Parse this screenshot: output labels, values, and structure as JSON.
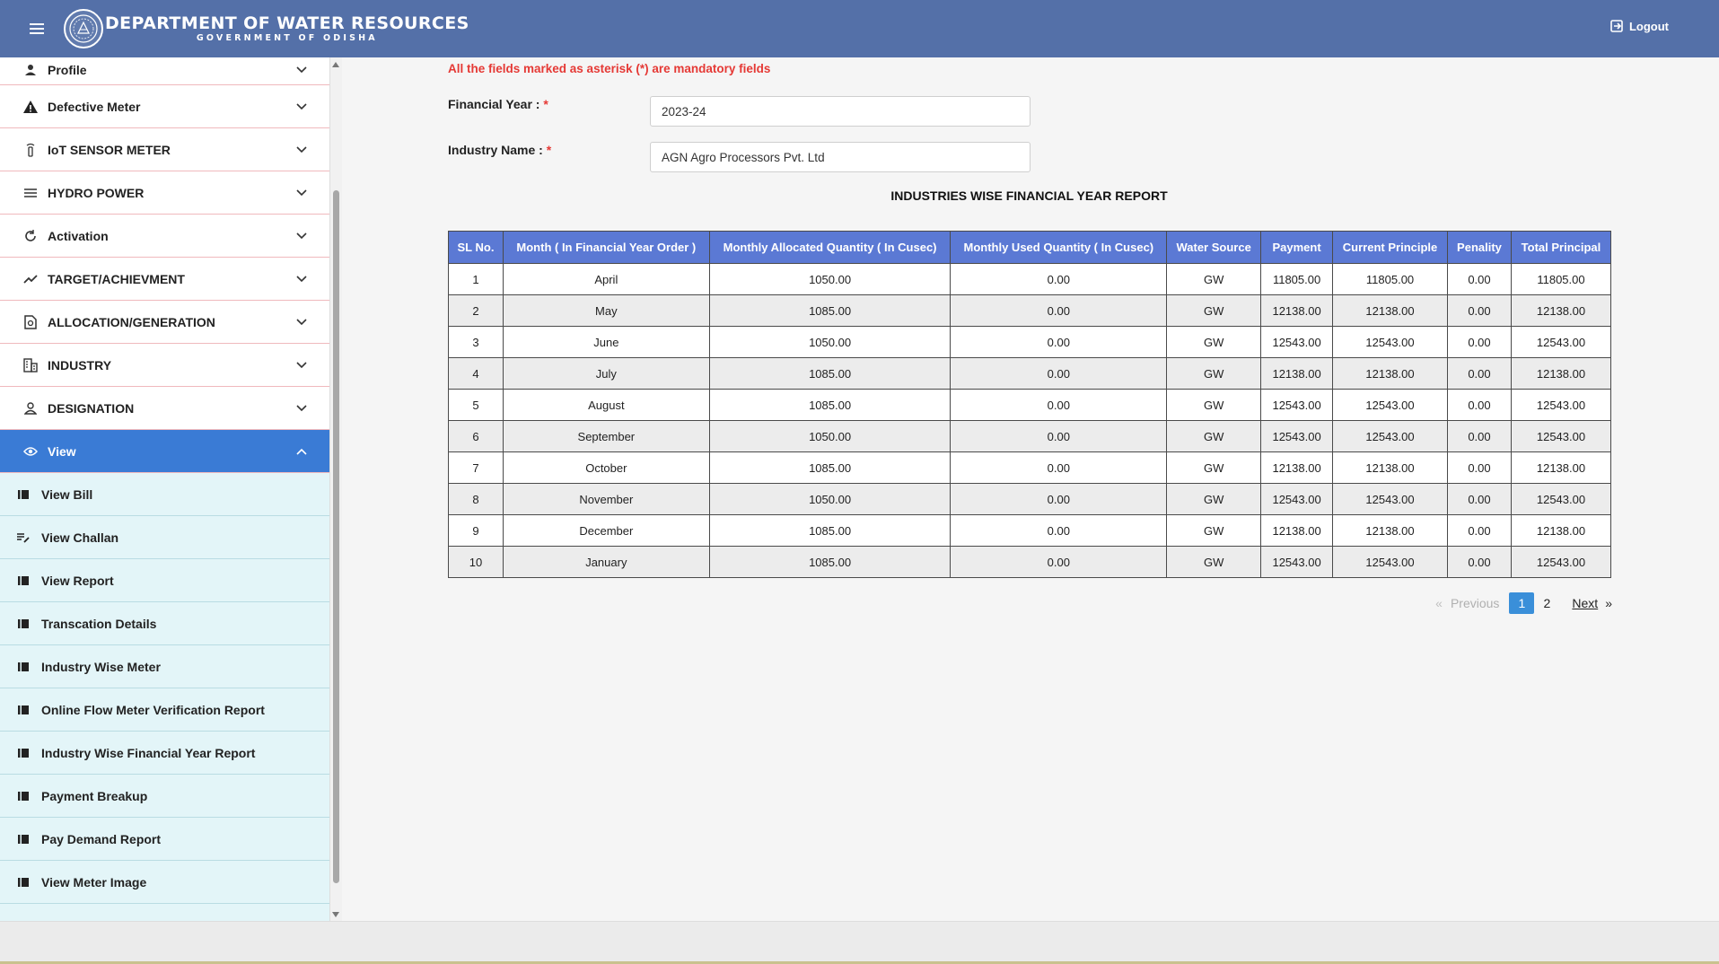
{
  "header": {
    "title": "DEPARTMENT OF WATER RESOURCES",
    "subtitle": "GOVERNMENT OF ODISHA",
    "logout_label": "Logout"
  },
  "sidebar": {
    "items": [
      {
        "label": "Profile",
        "icon": "person-icon"
      },
      {
        "label": "Defective Meter",
        "icon": "warning-icon"
      },
      {
        "label": "IoT SENSOR METER",
        "icon": "sensor-icon"
      },
      {
        "label": "HYDRO POWER",
        "icon": "waves-icon"
      },
      {
        "label": "Activation",
        "icon": "refresh-icon"
      },
      {
        "label": "TARGET/ACHIEVMENT",
        "icon": "trending-icon"
      },
      {
        "label": "ALLOCATION/GENERATION",
        "icon": "document-search-icon"
      },
      {
        "label": "INDUSTRY",
        "icon": "building-icon"
      },
      {
        "label": "DESIGNATION",
        "icon": "person-outline-icon"
      },
      {
        "label": "View",
        "icon": "eye-icon"
      }
    ],
    "sub_items": [
      {
        "label": "View Bill"
      },
      {
        "label": "View Challan"
      },
      {
        "label": "View Report"
      },
      {
        "label": "Transcation Details"
      },
      {
        "label": "Industry Wise Meter"
      },
      {
        "label": "Online Flow Meter Verification Report"
      },
      {
        "label": "Industry Wise Financial Year Report"
      },
      {
        "label": "Payment Breakup"
      },
      {
        "label": "Pay Demand Report"
      },
      {
        "label": "View Meter Image"
      }
    ]
  },
  "form": {
    "note": "All the fields marked as asterisk (*) are mandatory fields",
    "financial_year_label": "Financial Year :",
    "financial_year_value": "2023-24",
    "industry_name_label": "Industry Name :",
    "industry_name_value": "AGN Agro Processors Pvt. Ltd",
    "required_mark": "*"
  },
  "report": {
    "title": "INDUSTRIES WISE FINANCIAL YEAR REPORT",
    "columns": [
      "SL No.",
      "Month ( In Financial Year Order )",
      "Monthly Allocated Quantity ( In Cusec)",
      "Monthly Used Quantity ( In Cusec)",
      "Water Source",
      "Payment",
      "Current Principle",
      "Penality",
      "Total Principal"
    ],
    "rows": [
      [
        "1",
        "April",
        "1050.00",
        "0.00",
        "GW",
        "11805.00",
        "11805.00",
        "0.00",
        "11805.00"
      ],
      [
        "2",
        "May",
        "1085.00",
        "0.00",
        "GW",
        "12138.00",
        "12138.00",
        "0.00",
        "12138.00"
      ],
      [
        "3",
        "June",
        "1050.00",
        "0.00",
        "GW",
        "12543.00",
        "12543.00",
        "0.00",
        "12543.00"
      ],
      [
        "4",
        "July",
        "1085.00",
        "0.00",
        "GW",
        "12138.00",
        "12138.00",
        "0.00",
        "12138.00"
      ],
      [
        "5",
        "August",
        "1085.00",
        "0.00",
        "GW",
        "12543.00",
        "12543.00",
        "0.00",
        "12543.00"
      ],
      [
        "6",
        "September",
        "1050.00",
        "0.00",
        "GW",
        "12543.00",
        "12543.00",
        "0.00",
        "12543.00"
      ],
      [
        "7",
        "October",
        "1085.00",
        "0.00",
        "GW",
        "12138.00",
        "12138.00",
        "0.00",
        "12138.00"
      ],
      [
        "8",
        "November",
        "1050.00",
        "0.00",
        "GW",
        "12543.00",
        "12543.00",
        "0.00",
        "12543.00"
      ],
      [
        "9",
        "December",
        "1085.00",
        "0.00",
        "GW",
        "12138.00",
        "12138.00",
        "0.00",
        "12138.00"
      ],
      [
        "10",
        "January",
        "1085.00",
        "0.00",
        "GW",
        "12543.00",
        "12543.00",
        "0.00",
        "12543.00"
      ]
    ]
  },
  "pagination": {
    "prev_symbol": "«",
    "prev_label": "Previous",
    "pages": [
      "1",
      "2"
    ],
    "current_page": "1",
    "next_label": "Next",
    "next_symbol": "»"
  },
  "colors": {
    "header_bg": "#5470a8",
    "active_nav": "#3a7bd5",
    "table_header": "#5b79d4",
    "required": "#e53935",
    "submenu_bg": "#e3f5f8"
  }
}
